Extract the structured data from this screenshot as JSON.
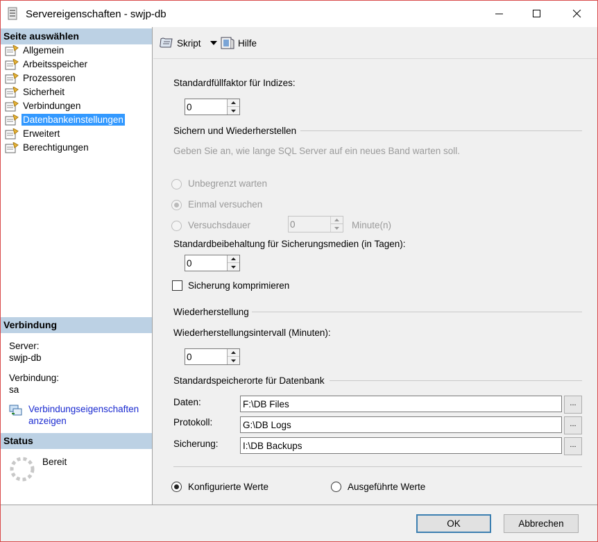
{
  "window": {
    "title": "Servereigenschaften - swjp-db"
  },
  "left": {
    "select_page_heading": "Seite auswählen",
    "pages": [
      {
        "label": "Allgemein",
        "selected": false
      },
      {
        "label": "Arbeitsspeicher",
        "selected": false
      },
      {
        "label": "Prozessoren",
        "selected": false
      },
      {
        "label": "Sicherheit",
        "selected": false
      },
      {
        "label": "Verbindungen",
        "selected": false
      },
      {
        "label": "Datenbankeinstellungen",
        "selected": true
      },
      {
        "label": "Erweitert",
        "selected": false
      },
      {
        "label": "Berechtigungen",
        "selected": false
      }
    ],
    "connection_heading": "Verbindung",
    "server_label": "Server:",
    "server_value": "swjp-db",
    "connection_label": "Verbindung:",
    "connection_value": "sa",
    "connection_link_line1": "Verbindungseigenschaften",
    "connection_link_line2": "anzeigen",
    "status_heading": "Status",
    "status_value": "Bereit"
  },
  "toolbar": {
    "script_label": "Skript",
    "help_label": "Hilfe"
  },
  "content": {
    "fill_factor_label": "Standardfüllfaktor für Indizes:",
    "fill_factor_value": "0",
    "backup_restore_group": "Sichern und Wiederherstellen",
    "backup_hint": "Geben Sie an, wie lange SQL Server auf ein neues Band warten soll.",
    "radio_unlimited": "Unbegrenzt warten",
    "radio_once": "Einmal versuchen",
    "radio_duration": "Versuchsdauer",
    "duration_value": "0",
    "duration_unit": "Minute(n)",
    "retention_label": "Standardbeibehaltung für Sicherungsmedien (in Tagen):",
    "retention_value": "0",
    "compress_label": "Sicherung komprimieren",
    "compress_checked": false,
    "recovery_group": "Wiederherstellung",
    "recovery_interval_label": "Wiederherstellungsintervall (Minuten):",
    "recovery_interval_value": "0",
    "locations_group": "Standardspeicherorte für Datenbank",
    "data_label": "Daten:",
    "data_value": "F:\\DB Files",
    "log_label": "Protokoll:",
    "log_value": "G:\\DB Logs",
    "backup_label": "Sicherung:",
    "backup_value": "I:\\DB Backups",
    "browse_label": "...",
    "configured_values": "Konfigurierte Werte",
    "running_values": "Ausgeführte Werte"
  },
  "footer": {
    "ok_label": "OK",
    "cancel_label": "Abbrechen"
  }
}
